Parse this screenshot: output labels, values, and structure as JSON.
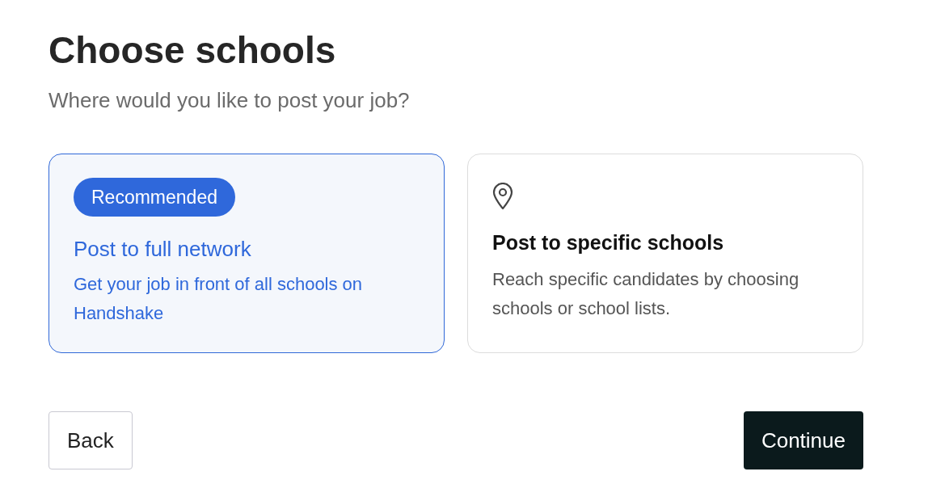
{
  "title": "Choose schools",
  "subtitle": "Where would you like to post your job?",
  "options": [
    {
      "kind": "badge",
      "badge": "Recommended",
      "title": "Post to full network",
      "description": "Get your job in front of all schools on Handshake",
      "selected": true
    },
    {
      "kind": "icon",
      "title": "Post to specific schools",
      "description": "Reach specific candidates by choosing schools or school lists.",
      "selected": false
    }
  ],
  "buttons": {
    "back": "Back",
    "continue": "Continue"
  }
}
